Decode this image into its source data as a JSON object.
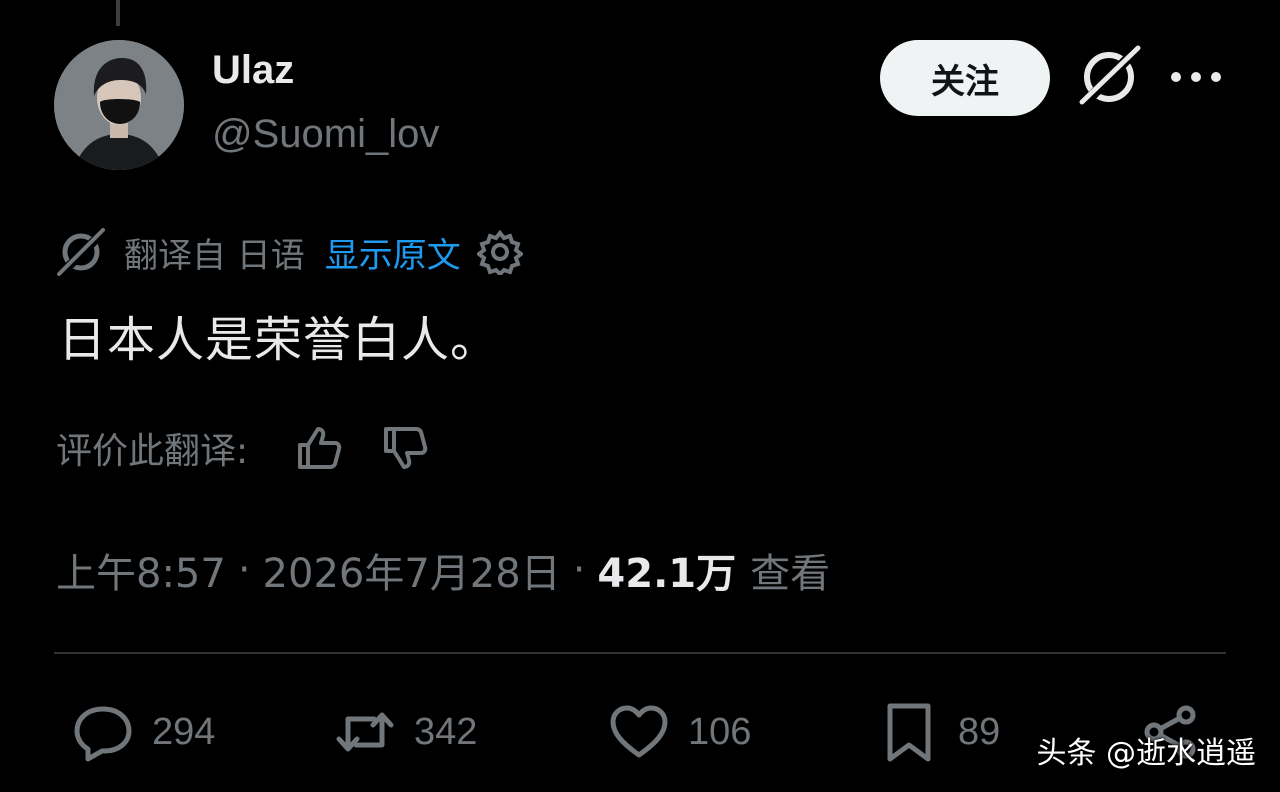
{
  "author": {
    "display_name": "Ulaz",
    "handle": "@Suomi_lov"
  },
  "header": {
    "follow_label": "关注",
    "grok_icon": "grok-icon",
    "more_icon": "more-icon"
  },
  "translation": {
    "label": "翻译自 日语",
    "show_original": "显示原文",
    "settings_icon": "gear-icon",
    "accent_color": "#1d9bf0"
  },
  "tweet": {
    "text": "日本人是荣誉白人。"
  },
  "rating": {
    "label": "评价此翻译:"
  },
  "meta": {
    "time": "上午8:57",
    "date": "2026年7月28日",
    "separator": "·",
    "views_count": "42.1万",
    "views_label": "查看"
  },
  "actions": {
    "replies": "294",
    "retweets": "342",
    "likes": "106",
    "bookmarks": "89"
  },
  "watermark": "头条 @逝水逍遥"
}
